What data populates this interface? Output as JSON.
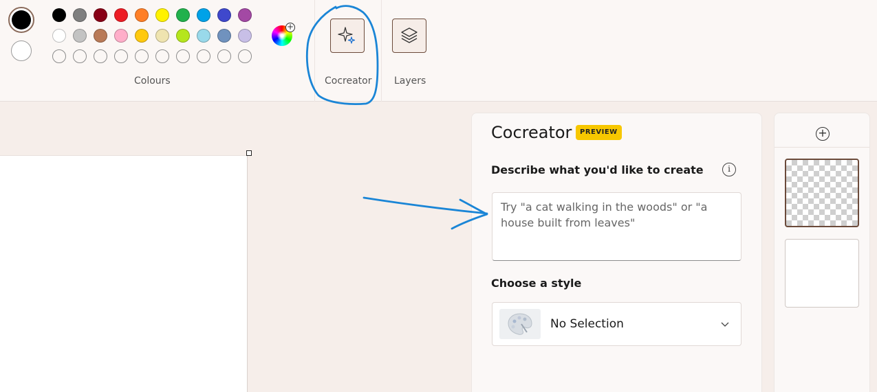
{
  "colours": {
    "label": "Colours",
    "primary": "#000000",
    "secondary": "#ffffff",
    "palette": [
      "#000000",
      "#7f7f7f",
      "#880015",
      "#ed1c24",
      "#ff7f27",
      "#fff200",
      "#22b14c",
      "#00a2e8",
      "#3f48cc",
      "#a349a4",
      "#ffffff",
      "#c3c3c3",
      "#b97a57",
      "#ffaec9",
      "#ffc90e",
      "#efe4b0",
      "#b5e61d",
      "#99d9ea",
      "#7092be",
      "#c8bfe7",
      "",
      "",
      "",
      "",
      "",
      "",
      "",
      "",
      "",
      ""
    ]
  },
  "toolbar": {
    "cocreator_label": "Cocreator",
    "layers_label": "Layers"
  },
  "cocreator": {
    "title": "Cocreator",
    "badge": "PREVIEW",
    "describe_label": "Describe what you'd like to create",
    "prompt_placeholder": "Try \"a cat walking in the woods\" or \"a house built from leaves\"",
    "prompt_value": "",
    "style_label": "Choose a style",
    "style_value": "No Selection"
  },
  "annotation_colors": {
    "ink": "#1a85d6"
  }
}
